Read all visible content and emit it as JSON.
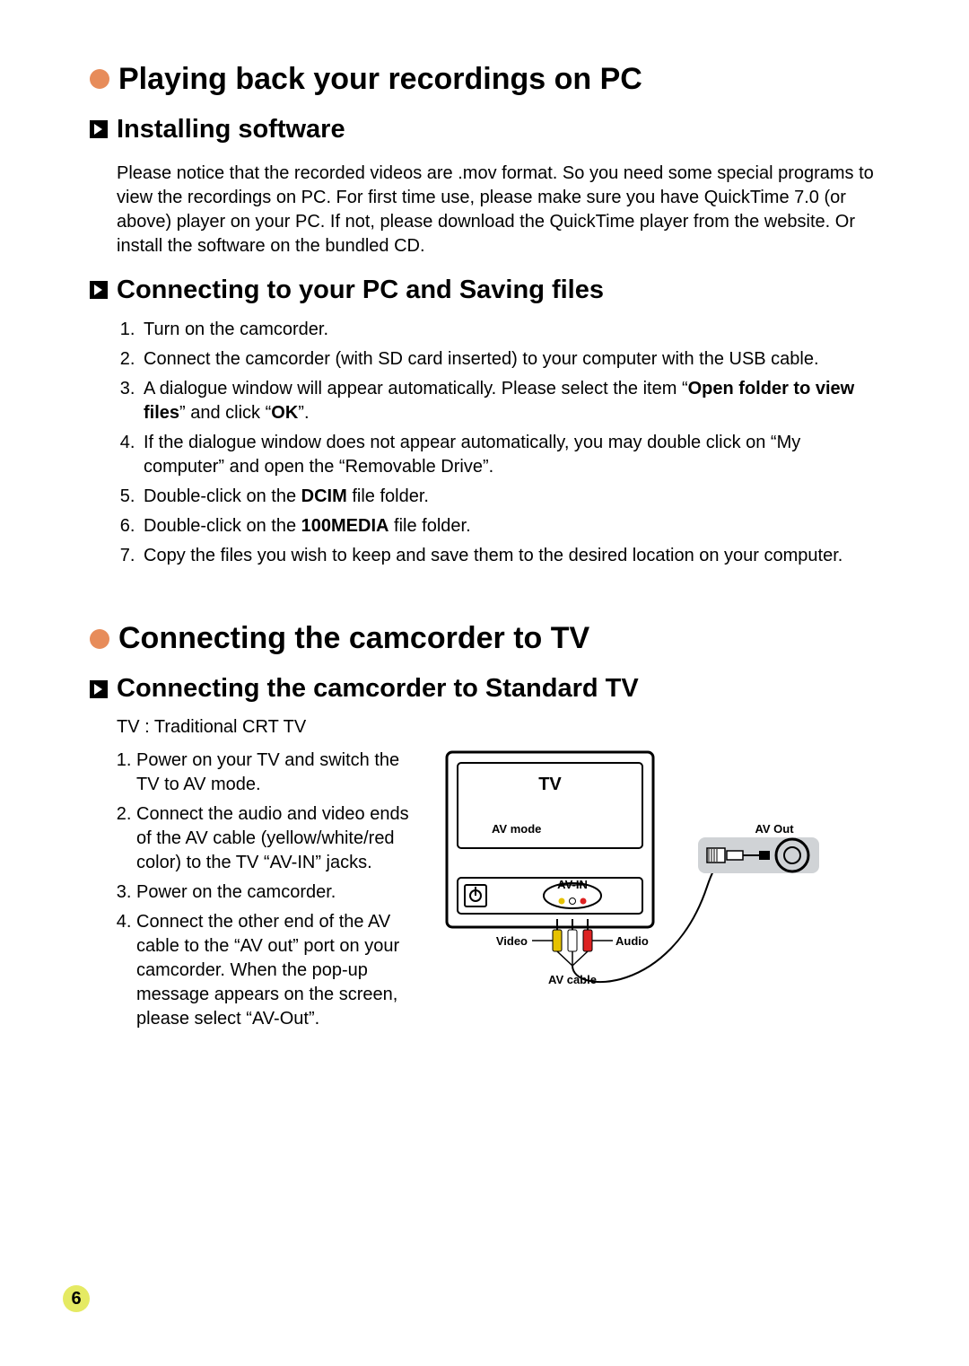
{
  "page_number": "6",
  "section1": {
    "title": "Playing back your recordings on PC",
    "sub1": {
      "title": "Installing software",
      "paragraph": "Please notice that the recorded videos are .mov format. So you need some special programs to view the recordings on PC. For first time use, please make sure you have QuickTime 7.0 (or above) player on your PC. If not, please download the QuickTime player from the website. Or install the software on the bundled CD."
    },
    "sub2": {
      "title": "Connecting to your PC and Saving files",
      "steps": [
        {
          "text": "Turn on the camcorder."
        },
        {
          "pre": "Connect the camcorder (with SD card inserted) to your computer with the USB cable."
        },
        {
          "pre": "A dialogue window will appear automatically. Please select the item “",
          "b1": "Open folder to view files",
          "mid": "” and click “",
          "b2": "OK",
          "post": "”."
        },
        {
          "text": "If the dialogue window does not appear automatically, you may double click on “My computer” and open the “Removable Drive”."
        },
        {
          "pre": "Double-click on the ",
          "b1": "DCIM",
          "post": " file folder."
        },
        {
          "pre": "Double-click on the ",
          "b1": "100MEDIA",
          "post": " file folder."
        },
        {
          "text": "Copy the files you wish to keep and save them to the desired location on your computer."
        }
      ]
    }
  },
  "section2": {
    "title": "Connecting the camcorder to TV",
    "sub1": {
      "title": "Connecting the camcorder to Standard TV",
      "note": "TV : Traditional CRT TV",
      "steps": [
        "Power on your TV and switch the TV to AV mode.",
        "Connect the audio and video ends of the AV cable (yellow/white/red color) to the TV “AV-IN” jacks.",
        "Power on the camcorder.",
        "Connect the other end of the AV cable to the “AV out” port on your camcorder. When the pop-up message appears on the screen, please select “AV-Out”."
      ]
    }
  },
  "diagram": {
    "tv_label": "TV",
    "av_mode": "AV mode",
    "av_in": "AV-IN",
    "video": "Video",
    "audio": "Audio",
    "av_cable": "AV cable",
    "av_out": "AV Out"
  }
}
